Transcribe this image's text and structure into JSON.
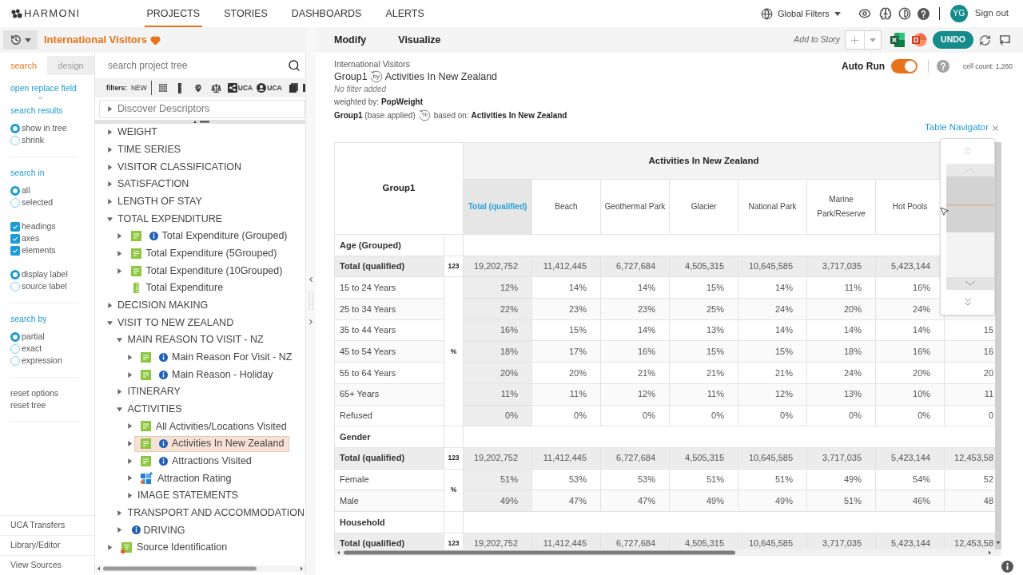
{
  "top_nav": {
    "logo": "HARMONI",
    "tabs": [
      {
        "label": "PROJECTS",
        "selected": true
      },
      {
        "label": "STORIES",
        "selected": false
      },
      {
        "label": "DASHBOARDS",
        "selected": false
      },
      {
        "label": "ALERTS",
        "selected": false
      }
    ],
    "global_filters": "Global Filters",
    "avatar": "YG",
    "sign_out": "Sign out"
  },
  "project_bar": {
    "title": "International Visitors",
    "favorite": true
  },
  "options_panel": {
    "tabs": [
      {
        "label": "search",
        "selected": true
      },
      {
        "label": "design",
        "selected": false
      }
    ],
    "replace_link": "open replace field",
    "groups": [
      {
        "heading": "search results",
        "sets": [
          [
            {
              "kind": "radio",
              "label": "show in tree",
              "selected": true
            },
            {
              "kind": "radio",
              "label": "shrink",
              "selected": false
            }
          ]
        ]
      },
      {
        "heading": "search in",
        "sets": [
          [
            {
              "kind": "radio",
              "label": "all",
              "selected": true
            },
            {
              "kind": "radio",
              "label": "selected",
              "selected": false
            }
          ],
          [
            {
              "kind": "checkbox",
              "label": "headings",
              "checked": true
            },
            {
              "kind": "checkbox",
              "label": "axes",
              "checked": true
            },
            {
              "kind": "checkbox",
              "label": "elements",
              "checked": true
            }
          ],
          [
            {
              "kind": "radio",
              "label": "display label",
              "selected": true
            },
            {
              "kind": "radio",
              "label": "source label",
              "selected": false
            }
          ]
        ]
      },
      {
        "heading": "search by",
        "sets": [
          [
            {
              "kind": "radio",
              "label": "partial",
              "selected": true
            },
            {
              "kind": "radio",
              "label": "exact",
              "selected": false
            },
            {
              "kind": "radio",
              "label": "expression",
              "selected": false
            }
          ]
        ]
      }
    ],
    "reset_links": [
      "reset options",
      "reset tree"
    ],
    "footer_links": [
      "UCA Transfers",
      "Library/Editor",
      "View Sources"
    ]
  },
  "tree_panel": {
    "search": {
      "placeholder": "search project tree"
    },
    "filters_label": "filters:",
    "filter_buttons": [
      {
        "kind": "new",
        "label": "NEW"
      },
      {
        "kind": "grid"
      },
      {
        "kind": "ruler"
      },
      {
        "kind": "pin"
      },
      {
        "kind": "scale"
      },
      {
        "kind": "share",
        "label": "UCA"
      },
      {
        "kind": "user",
        "label": "UCA"
      },
      {
        "kind": "stack"
      },
      {
        "kind": "bar"
      }
    ],
    "pinned": [
      {
        "label": "Discover Descriptors",
        "kind": "folder",
        "info": false,
        "expanded": false,
        "selected": false
      }
    ],
    "items": [
      {
        "label": "WEIGHT",
        "kind": "folder",
        "info": false,
        "expanded": false,
        "selected": false
      },
      {
        "label": "TIME SERIES",
        "kind": "folder",
        "info": false,
        "expanded": false,
        "selected": false
      },
      {
        "label": "VISITOR CLASSIFICATION",
        "kind": "folder",
        "info": false,
        "expanded": false,
        "selected": false
      },
      {
        "label": "SATISFACTION",
        "kind": "folder",
        "info": false,
        "expanded": false,
        "selected": false
      },
      {
        "label": "LENGTH OF STAY",
        "kind": "folder",
        "info": false,
        "expanded": false,
        "selected": false
      },
      {
        "label": "TOTAL EXPENDITURE",
        "kind": "folder",
        "info": false,
        "expanded": true,
        "selected": false,
        "children": [
          {
            "label": "Total Expenditure (Grouped)",
            "kind": "variable",
            "info": true,
            "expanded": false,
            "selected": false
          },
          {
            "label": "Total Expenditure (5Grouped)",
            "kind": "variable",
            "info": false,
            "expanded": false,
            "selected": false
          },
          {
            "label": "Total Expenditure (10Grouped)",
            "kind": "variable",
            "info": false,
            "expanded": false,
            "selected": false
          },
          {
            "label": "Total Expenditure",
            "kind": "numeric",
            "info": false,
            "selected": false
          }
        ]
      },
      {
        "label": "DECISION MAKING",
        "kind": "folder",
        "info": false,
        "expanded": false,
        "selected": false
      },
      {
        "label": "VISIT TO NEW ZEALAND",
        "kind": "folder",
        "info": false,
        "expanded": true,
        "selected": false,
        "children": [
          {
            "label": "MAIN REASON TO VISIT - NZ",
            "kind": "folder",
            "info": false,
            "expanded": true,
            "selected": false,
            "children": [
              {
                "label": "Main Reason For Visit - NZ",
                "kind": "variable",
                "info": true,
                "expanded": false,
                "selected": false
              },
              {
                "label": "Main Reason - Holiday",
                "kind": "variable",
                "info": true,
                "expanded": false,
                "selected": false
              }
            ]
          },
          {
            "label": "ITINERARY",
            "kind": "folder",
            "info": false,
            "expanded": false,
            "selected": false
          },
          {
            "label": "ACTIVITIES",
            "kind": "folder",
            "info": false,
            "expanded": true,
            "selected": false,
            "children": [
              {
                "label": "All Activities/Locations Visited",
                "kind": "variable",
                "info": false,
                "expanded": false,
                "selected": false
              },
              {
                "label": "Activities In New Zealand",
                "kind": "variable",
                "info": true,
                "expanded": false,
                "selected": true
              },
              {
                "label": "Attractions Visited",
                "kind": "variable",
                "info": true,
                "expanded": false,
                "selected": false
              },
              {
                "label": "Attraction Rating",
                "kind": "grid",
                "info": false,
                "expanded": false,
                "selected": false
              },
              {
                "label": "IMAGE STATEMENTS",
                "kind": "folder",
                "info": false,
                "expanded": false,
                "selected": false
              }
            ]
          },
          {
            "label": "TRANSPORT AND ACCOMMODATION",
            "kind": "folder",
            "info": false,
            "expanded": false,
            "selected": false
          },
          {
            "label": "DRIVING",
            "kind": "folder",
            "info": true,
            "expanded": false,
            "selected": false
          }
        ]
      },
      {
        "label": "Source Identification",
        "kind": "filtered",
        "info": false,
        "expanded": false,
        "selected": false
      }
    ]
  },
  "toolbar": {
    "tabs": [
      "Modify",
      "Visualize"
    ],
    "add_to_story": "Add to Story",
    "undo": "UNDO"
  },
  "report": {
    "project": "International Visitors",
    "rows_var": "Group1",
    "by": "by",
    "cols_var": "Activities In New Zealand",
    "filter": "No filter added",
    "weighted": "weighted by: **PopWeight**",
    "base": "**Group1** (base applied)",
    "percent": "%",
    "based_on": "based on: **Activities In New Zealand**",
    "auto_run": {
      "label": "Auto Run",
      "on": true
    },
    "cell_count": "cell count: 1,260",
    "navigator_link": "Table Navigator"
  },
  "table": {
    "corner": "Group1",
    "banner": "Activities In New Zealand",
    "columns": [
      {
        "label": "Total (qualified)",
        "kind": "total"
      },
      {
        "label": "Beach",
        "kind": "category"
      },
      {
        "label": "Geothermal Park",
        "kind": "category"
      },
      {
        "label": "Glacier",
        "kind": "category"
      },
      {
        "label": "National Park",
        "kind": "category"
      },
      {
        "label": "Marine Park/Reserve",
        "kind": "category"
      },
      {
        "label": "Hot Pools",
        "kind": "category"
      }
    ],
    "sections": [
      {
        "title": "Age (Grouped)",
        "total": {
          "label": "Total (qualified)",
          "unit": "123",
          "values": [
            "19,202,752",
            "11,412,445",
            "6,727,684",
            "4,505,315",
            "10,645,585",
            "3,717,035",
            "5,423,144"
          ]
        },
        "unit": "%",
        "rows": [
          {
            "label": "15 to 24 Years",
            "values": [
              "12%",
              "14%",
              "14%",
              "15%",
              "14%",
              "11%",
              "16%"
            ]
          },
          {
            "label": "25 to 34 Years",
            "values": [
              "22%",
              "23%",
              "23%",
              "25%",
              "24%",
              "20%",
              "24%"
            ]
          },
          {
            "label": "35 to 44 Years",
            "values": [
              "16%",
              "15%",
              "14%",
              "13%",
              "14%",
              "14%",
              "14%",
              "15"
            ]
          },
          {
            "label": "45 to 54 Years",
            "values": [
              "18%",
              "17%",
              "16%",
              "15%",
              "15%",
              "18%",
              "16%",
              "16"
            ]
          },
          {
            "label": "55 to 64 Years",
            "values": [
              "20%",
              "20%",
              "21%",
              "21%",
              "21%",
              "24%",
              "20%",
              "20"
            ]
          },
          {
            "label": "65+ Years",
            "values": [
              "11%",
              "11%",
              "12%",
              "11%",
              "12%",
              "13%",
              "10%",
              "11"
            ]
          },
          {
            "label": "Refused",
            "values": [
              "0%",
              "0%",
              "0%",
              "0%",
              "0%",
              "0%",
              "0%",
              "0"
            ]
          }
        ]
      },
      {
        "title": "Gender",
        "total": {
          "label": "Total (qualified)",
          "unit": "123",
          "values": [
            "19,202,752",
            "11,412,445",
            "6,727,684",
            "4,505,315",
            "10,645,585",
            "3,717,035",
            "5,423,144",
            "12,453,58"
          ]
        },
        "unit": "%",
        "rows": [
          {
            "label": "Female",
            "values": [
              "51%",
              "53%",
              "53%",
              "51%",
              "51%",
              "49%",
              "54%",
              "52"
            ]
          },
          {
            "label": "Male",
            "values": [
              "49%",
              "47%",
              "47%",
              "49%",
              "49%",
              "51%",
              "46%",
              "48"
            ]
          }
        ]
      },
      {
        "title": "Household",
        "total": {
          "label": "Total (qualified)",
          "unit": "123",
          "values": [
            "19,202,752",
            "11,412,445",
            "6,727,684",
            "4,505,315",
            "10,645,585",
            "3,717,035",
            "5,423,144",
            "12,453,58"
          ]
        }
      }
    ]
  }
}
